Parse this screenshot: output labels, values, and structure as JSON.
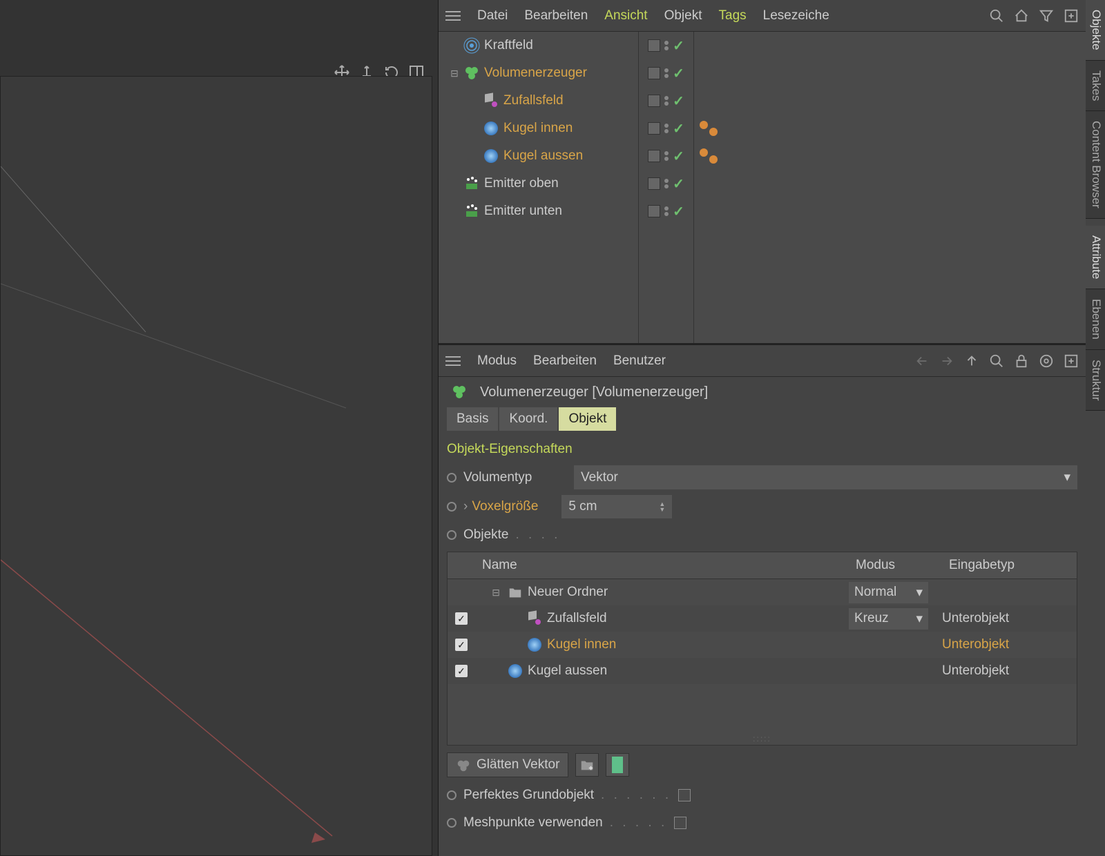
{
  "obj_menu": {
    "datei": "Datei",
    "bearbeiten": "Bearbeiten",
    "ansicht": "Ansicht",
    "objekt": "Objekt",
    "tags": "Tags",
    "lesezeiche": "Lesezeiche"
  },
  "obj_tree": [
    {
      "name": "Kraftfeld",
      "icon": "force",
      "hl": false,
      "indent": 0,
      "expander": "",
      "tags": []
    },
    {
      "name": "Volumenerzeuger",
      "icon": "volume",
      "hl": true,
      "indent": 0,
      "expander": "-",
      "tags": []
    },
    {
      "name": "Zufallsfeld",
      "icon": "random",
      "hl": true,
      "indent": 1,
      "expander": "",
      "tags": []
    },
    {
      "name": "Kugel innen",
      "icon": "sphere",
      "hl": true,
      "indent": 1,
      "expander": "",
      "tags": [
        "ball",
        "ball"
      ]
    },
    {
      "name": "Kugel aussen",
      "icon": "sphere",
      "hl": true,
      "indent": 1,
      "expander": "",
      "tags": [
        "ball",
        "ball"
      ]
    },
    {
      "name": "Emitter oben",
      "icon": "emitter",
      "hl": false,
      "indent": 0,
      "expander": "",
      "tags": []
    },
    {
      "name": "Emitter unten",
      "icon": "emitter",
      "hl": false,
      "indent": 0,
      "expander": "",
      "tags": []
    }
  ],
  "attr_menu": {
    "modus": "Modus",
    "bearbeiten": "Bearbeiten",
    "benutzer": "Benutzer"
  },
  "attr_title": "Volumenerzeuger [Volumenerzeuger]",
  "attr_tabs": {
    "basis": "Basis",
    "koord": "Koord.",
    "objekt": "Objekt"
  },
  "section_title": "Objekt-Eigenschaften",
  "props": {
    "volumentyp_label": "Volumentyp",
    "volumentyp_value": "Vektor",
    "voxel_label": "Voxelgröße",
    "voxel_value": "5 cm",
    "objekte_label": "Objekte"
  },
  "sub_headers": {
    "name": "Name",
    "modus": "Modus",
    "eingabetyp": "Eingabetyp"
  },
  "sub_rows": [
    {
      "checked": null,
      "name": "Neuer Ordner",
      "icon": "folder",
      "mode": "Normal",
      "type": "",
      "indent": 0,
      "exp": "-",
      "hl": false
    },
    {
      "checked": true,
      "name": "Zufallsfeld",
      "icon": "random",
      "mode": "Kreuz",
      "type": "Unterobjekt",
      "indent": 1,
      "exp": "",
      "hl": false
    },
    {
      "checked": true,
      "name": "Kugel innen",
      "icon": "sphere",
      "mode": "",
      "type": "Unterobjekt",
      "indent": 1,
      "exp": "",
      "hl": true
    },
    {
      "checked": true,
      "name": "Kugel aussen",
      "icon": "sphere",
      "mode": "",
      "type": "Unterobjekt",
      "indent": 0,
      "exp": "",
      "hl": false
    }
  ],
  "smooth_label": "Glätten Vektor",
  "perfekt_label": "Perfektes Grundobjekt",
  "mesh_label": "Meshpunkte verwenden",
  "side_tabs": {
    "objekte": "Objekte",
    "takes": "Takes",
    "content": "Content Browser",
    "attribute": "Attribute",
    "ebenen": "Ebenen",
    "struktur": "Struktur"
  }
}
